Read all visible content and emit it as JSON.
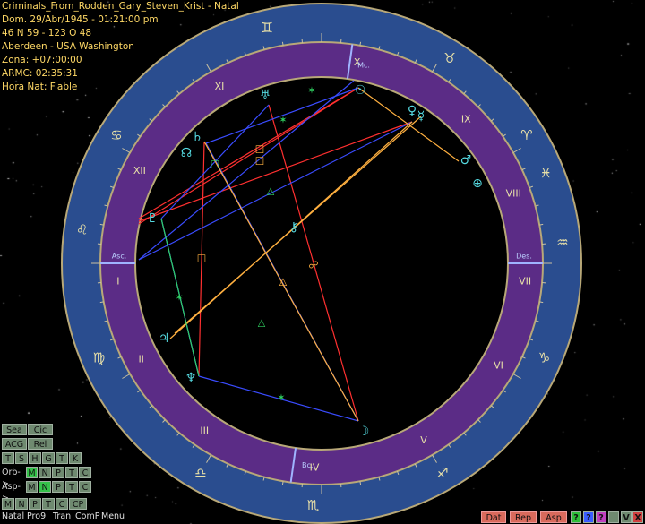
{
  "header": {
    "title": "Criminals_From_Rodden_Gary_Steven_Krist - Natal",
    "date": "Dom. 29/Abr/1945 - 01:21:00 pm",
    "coords": "46 N 59 - 123 O 48",
    "place": "Aberdeen - USA Washington",
    "zone": "Zona: +07:00:00",
    "armc": "ARMC: 02:35:31",
    "time_reliability": "Hora Nat: Fiable"
  },
  "angles": {
    "asc": "Asc.",
    "des": "Des.",
    "mc": "Mc.",
    "ic": "Bc."
  },
  "colors": {
    "outer_ring": "#2a4d8f",
    "inner_ring": "#5b2c86",
    "rim": "#b8a878",
    "house_numeral": "#e8e0a8",
    "planet": "#55d9e0",
    "aspect_red": "#ff3030",
    "aspect_blue": "#3a4cff",
    "aspect_orange": "#ffb040",
    "aspect_green": "#2fd060"
  },
  "houses": [
    "I",
    "II",
    "III",
    "IV",
    "V",
    "VI",
    "VII",
    "VIII",
    "IX",
    "X",
    "XI",
    "XII"
  ],
  "signs": [
    "♈",
    "♉",
    "♊",
    "♋",
    "♌",
    "♍",
    "♎",
    "♏",
    "♐",
    "♑",
    "♒",
    "♓"
  ],
  "planets": [
    {
      "name": "Sol",
      "glyph": "☉"
    },
    {
      "name": "Luna",
      "glyph": "☽"
    },
    {
      "name": "Mercurio",
      "glyph": "☿"
    },
    {
      "name": "Venus",
      "glyph": "♀"
    },
    {
      "name": "Marte",
      "glyph": "♂"
    },
    {
      "name": "Jupiter",
      "glyph": "♃"
    },
    {
      "name": "Saturno",
      "glyph": "♄"
    },
    {
      "name": "Urano",
      "glyph": "♅"
    },
    {
      "name": "Neptuno",
      "glyph": "♆"
    },
    {
      "name": "Pluton",
      "glyph": "♇"
    },
    {
      "name": "Quiron",
      "glyph": "⚷"
    },
    {
      "name": "Nodo",
      "glyph": "☊"
    },
    {
      "name": "Parte Fortuna",
      "glyph": "⊕"
    }
  ],
  "aspect_glyphs": {
    "conj": "☌",
    "opp": "☍",
    "sq": "□",
    "tri": "△",
    "sext": "✶",
    "semisext": "⚺"
  },
  "panel": {
    "row1": [
      "Sea",
      "Cic"
    ],
    "row2": [
      "ACG",
      "Rel"
    ],
    "row3": [
      "T",
      "S",
      "H",
      "G",
      "T",
      "K"
    ],
    "orb_label": "Orb->",
    "orb": [
      "M",
      "N",
      "P",
      "T",
      "C"
    ],
    "asp_label": "Asp->",
    "asp": [
      "M",
      "N",
      "P",
      "T",
      "C"
    ],
    "row6": [
      "M",
      "N",
      "P",
      "T",
      "C",
      "CP"
    ]
  },
  "menu": [
    "Natal",
    "Pro9",
    "Tran",
    "ComP",
    "Menu"
  ],
  "bottom_buttons": [
    "Dat",
    "Rep",
    "Asp"
  ],
  "bottom_icons": [
    "?",
    "?",
    "?",
    "V",
    "X"
  ]
}
